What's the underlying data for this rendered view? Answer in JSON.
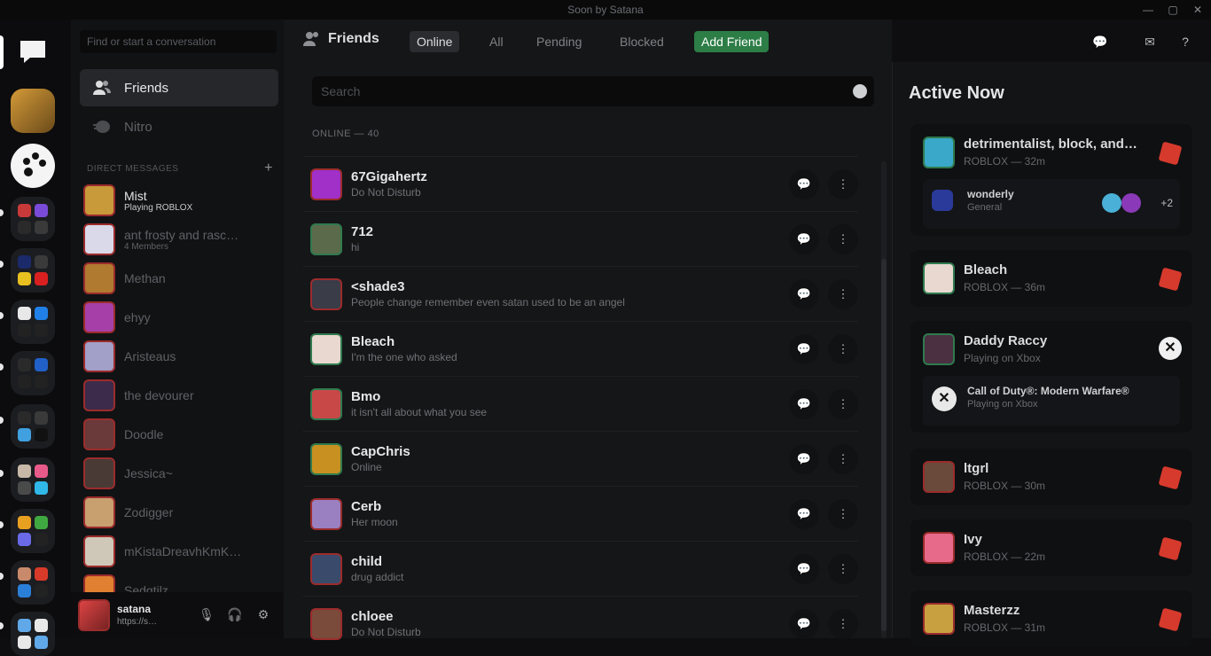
{
  "window": {
    "title": "Soon by Satana"
  },
  "dm_search": {
    "placeholder": "Find or start a conversation"
  },
  "nav": [
    {
      "label": "Friends",
      "icon": "friends-icon"
    },
    {
      "label": "Nitro",
      "icon": "nitro-icon"
    }
  ],
  "dm_header": "DIRECT MESSAGES",
  "dms": [
    {
      "name": "Mist",
      "sub": "Playing ROBLOX",
      "color": "#c89a3a"
    },
    {
      "name": "ant frosty and rasc…",
      "sub": "4 Members",
      "color": "#d9d9e9"
    },
    {
      "name": "Methan",
      "sub": "",
      "color": "#b07a30"
    },
    {
      "name": "ehyy",
      "sub": "",
      "color": "#a640a8"
    },
    {
      "name": "Aristeaus",
      "sub": "",
      "color": "#a2a0c8"
    },
    {
      "name": "the devourer",
      "sub": "",
      "color": "#3c2b4a"
    },
    {
      "name": "Doodle",
      "sub": "",
      "color": "#6a3a3a"
    },
    {
      "name": "Jessica~",
      "sub": "",
      "color": "#4a3a36"
    },
    {
      "name": "Zodigger",
      "sub": "",
      "color": "#c8a070"
    },
    {
      "name": "mKistaDreavhKmK…",
      "sub": "",
      "color": "#cfc8b8"
    },
    {
      "name": "Sedgtilz",
      "sub": "",
      "color": "#e08030"
    }
  ],
  "user": {
    "name": "satana",
    "status": "https://s…"
  },
  "topbar": {
    "title": "Friends",
    "tabs": [
      "Online",
      "All",
      "Pending",
      "Blocked"
    ],
    "add_friend": "Add Friend"
  },
  "friend_search": {
    "placeholder": "Search"
  },
  "online_header": "ONLINE — 40",
  "friends": [
    {
      "name": "67Gigahertz",
      "status": "Do Not Disturb",
      "color": "#a030c8",
      "ring": "r"
    },
    {
      "name": "712",
      "status": "hi",
      "color": "#5a6a4a",
      "ring": "g"
    },
    {
      "name": "<shade3",
      "status": "People change remember even satan used to be an angel",
      "color": "#3a3c48",
      "ring": "r"
    },
    {
      "name": "Bleach",
      "status": "I'm the one who asked",
      "color": "#e8d8d0",
      "ring": "g"
    },
    {
      "name": "Bmo",
      "status": "it isn't all about what you see",
      "color": "#c84848",
      "ring": "g"
    },
    {
      "name": "CapChris",
      "status": "Online",
      "color": "#c89020",
      "ring": "g"
    },
    {
      "name": "Cerb",
      "status": "Her moon",
      "color": "#9a80c0",
      "ring": "r"
    },
    {
      "name": "child",
      "status": "drug addict",
      "color": "#3a4a6a",
      "ring": "r"
    },
    {
      "name": "chloee",
      "status": "Do Not Disturb",
      "color": "#7a4a3a",
      "ring": "r"
    }
  ],
  "active_now": {
    "title": "Active Now",
    "cards": [
      {
        "name": "detrimentalist, block, and…",
        "sub": "ROBLOX — 32m",
        "color": "#3aa8c8",
        "ring": "g",
        "game": "roblox",
        "voice": {
          "server": "wonderly",
          "channel": "General",
          "extra": "+2"
        }
      },
      {
        "name": "Bleach",
        "sub": "ROBLOX — 36m",
        "color": "#e8d8d0",
        "ring": "g",
        "game": "roblox"
      },
      {
        "name": "Daddy Raccy",
        "sub": "Playing on Xbox",
        "color": "#4a3040",
        "ring": "g",
        "game": "xbox",
        "activity": {
          "title": "Call of Duty®: Modern Warfare®",
          "sub": "Playing on Xbox"
        }
      },
      {
        "name": "ltgrl",
        "sub": "ROBLOX — 30m",
        "color": "#6a4a3a",
        "ring": "r",
        "game": "roblox"
      },
      {
        "name": "Ivy",
        "sub": "ROBLOX — 22m",
        "color": "#e86a8a",
        "ring": "r",
        "game": "roblox"
      },
      {
        "name": "Masterzz",
        "sub": "ROBLOX — 31m",
        "color": "#c8a040",
        "ring": "r",
        "game": "roblox"
      }
    ]
  }
}
